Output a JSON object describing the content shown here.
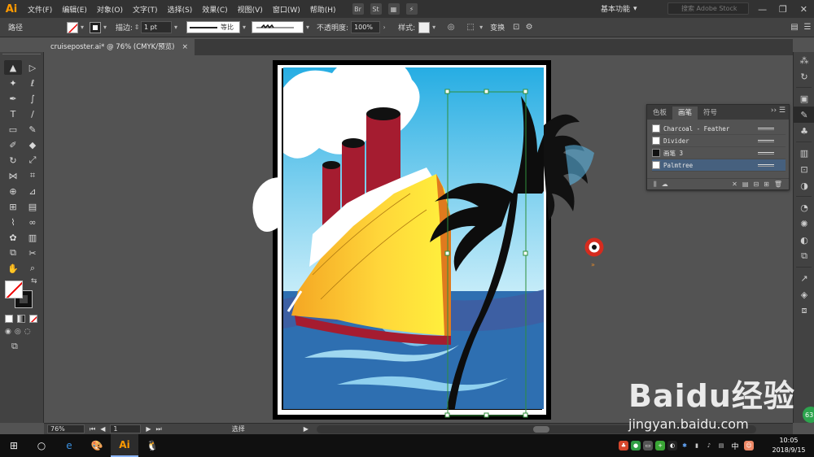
{
  "app": {
    "logo": "Ai"
  },
  "menu": [
    "文件(F)",
    "编辑(E)",
    "对象(O)",
    "文字(T)",
    "选择(S)",
    "效果(C)",
    "视图(V)",
    "窗口(W)",
    "帮助(H)"
  ],
  "menubar_icons": {
    "bridge": "Br",
    "stock": "St",
    "layout": "▦",
    "gpu": "⚡"
  },
  "workspace": {
    "label": "基本功能",
    "search_placeholder": "搜索 Adobe Stock"
  },
  "window_controls": {
    "minimize": "—",
    "restore": "❐",
    "close": "✕"
  },
  "control_bar": {
    "selection_label": "路径",
    "stroke_label": "描边:",
    "stroke_weight": "1 pt",
    "profile_label": "等比",
    "opacity_label": "不透明度:",
    "opacity_value": "100%",
    "style_label": "样式:",
    "transform_label": "变换"
  },
  "document_tab": {
    "title": "cruiseposter.ai* @ 76% (CMYK/预览)",
    "close": "×"
  },
  "tools": [
    {
      "name": "selection-tool",
      "glyph": "▲"
    },
    {
      "name": "direct-selection-tool",
      "glyph": "▷"
    },
    {
      "name": "magic-wand-tool",
      "glyph": "✦"
    },
    {
      "name": "lasso-tool",
      "glyph": "ℓ"
    },
    {
      "name": "pen-tool",
      "glyph": "✒"
    },
    {
      "name": "curvature-tool",
      "glyph": "∫"
    },
    {
      "name": "type-tool",
      "glyph": "T"
    },
    {
      "name": "line-tool",
      "glyph": "/"
    },
    {
      "name": "rectangle-tool",
      "glyph": "▭"
    },
    {
      "name": "paintbrush-tool",
      "glyph": "✎"
    },
    {
      "name": "shaper-tool",
      "glyph": "✐"
    },
    {
      "name": "eraser-tool",
      "glyph": "◆"
    },
    {
      "name": "rotate-tool",
      "glyph": "↻"
    },
    {
      "name": "scale-tool",
      "glyph": "⤢"
    },
    {
      "name": "width-tool",
      "glyph": "⋈"
    },
    {
      "name": "free-transform-tool",
      "glyph": "⌗"
    },
    {
      "name": "shape-builder-tool",
      "glyph": "⊕"
    },
    {
      "name": "perspective-grid-tool",
      "glyph": "⊿"
    },
    {
      "name": "mesh-tool",
      "glyph": "⊞"
    },
    {
      "name": "gradient-tool",
      "glyph": "▤"
    },
    {
      "name": "eyedropper-tool",
      "glyph": "⌇"
    },
    {
      "name": "blend-tool",
      "glyph": "∞"
    },
    {
      "name": "symbol-sprayer-tool",
      "glyph": "✿"
    },
    {
      "name": "column-graph-tool",
      "glyph": "▥"
    },
    {
      "name": "artboard-tool",
      "glyph": "⧉"
    },
    {
      "name": "slice-tool",
      "glyph": "✂"
    },
    {
      "name": "hand-tool",
      "glyph": "✋"
    },
    {
      "name": "zoom-tool",
      "glyph": "⌕"
    }
  ],
  "brushes_panel": {
    "tabs": [
      "色板",
      "画笔",
      "符号"
    ],
    "more": "››",
    "items": [
      {
        "name": "Charcoal - Feather",
        "selected": false
      },
      {
        "name": "Divider",
        "selected": false
      },
      {
        "name": "画笔 3",
        "selected": false
      },
      {
        "name": "Palmtree",
        "selected": true
      }
    ]
  },
  "right_dock_icons": [
    "character-styles-icon",
    "properties-icon",
    "brushes-icon",
    "symbols-icon",
    "align-icon",
    "transform-icon",
    "appearance-icon",
    "graphic-styles-icon",
    "color-guide-icon",
    "links-icon",
    "export-icon",
    "layers-icon",
    "artboards-icon"
  ],
  "status_bar": {
    "zoom": "76%",
    "artboard": "1",
    "tool_status": "选择"
  },
  "taskbar": {
    "time": "10:05",
    "date": "2018/9/15",
    "ime": "中",
    "apps": [
      "start-icon",
      "cortana-icon",
      "edge-icon",
      "paint-icon",
      "illustrator-icon",
      "qq-icon"
    ]
  },
  "watermark": {
    "text": "Baidu经验",
    "url": "jingyan.baidu.com"
  },
  "badge": "63",
  "colors": {
    "menubar": "#323232",
    "panel": "#424242",
    "canvas": "#535353",
    "accent": "#ff9a00",
    "selection": "#46607e",
    "sky": "#2bb3e6",
    "sea": "#2e6fb1",
    "hull": "#f7c21c"
  }
}
